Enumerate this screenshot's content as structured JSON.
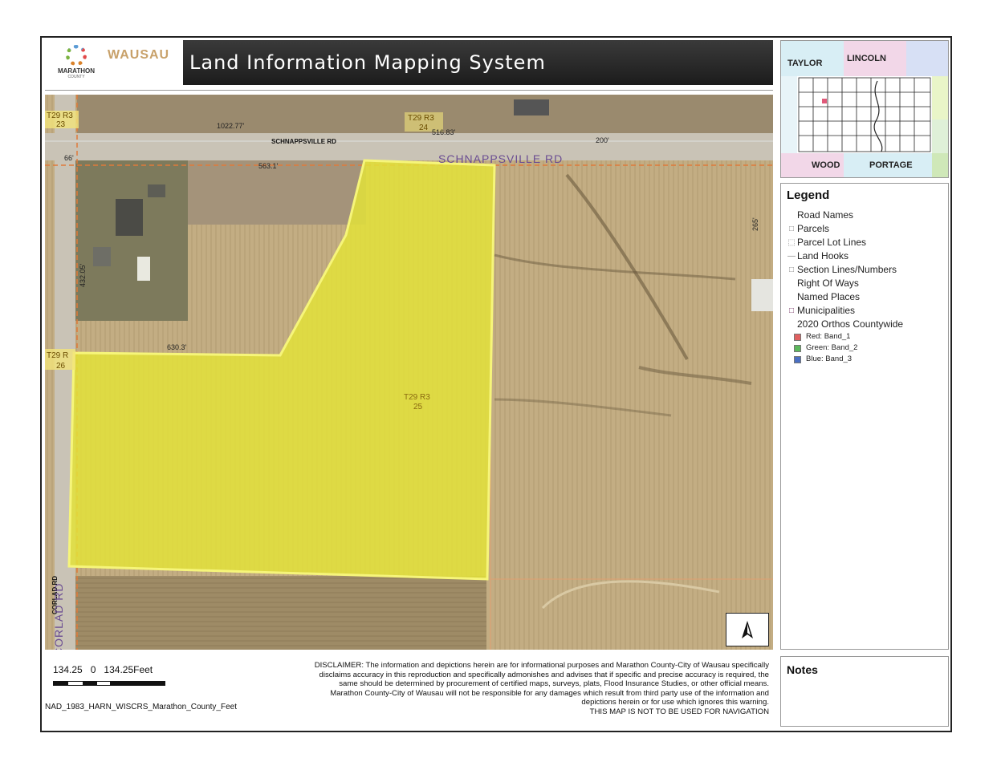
{
  "header": {
    "title": "Land Information Mapping System",
    "logo_marathon_line1": "MARATHON",
    "logo_marathon_line2": "COUNTY",
    "logo_wausau": "WAUSAU"
  },
  "map": {
    "roads": {
      "schnappsville_small": "SCHNAPPSVILLE RD",
      "schnappsville_large": "SCHNAPPSVILLE RD",
      "corlad_small": "CORLAD RD",
      "corlad_large": "CORLAD RD"
    },
    "sections": {
      "t29r3_23": "T29 R3",
      "t29r3_23_num": "23",
      "t29r3_24": "T29 R3",
      "t29r3_24_num": "24",
      "t29r_26": "T29 R",
      "t29r_26_num": "26",
      "t29r3_25": "T29 R3",
      "t29r3_25_num": "25"
    },
    "dimensions": {
      "d1022": "1022.77'",
      "d516": "516.83'",
      "d200": "200'",
      "d563": "563.1'",
      "d66": "66'",
      "d630": "630.3'",
      "d432": "432.05'",
      "d265": "265'"
    },
    "parcel_color": "#e3e23a"
  },
  "locator": {
    "counties": [
      "TAYLOR",
      "LINCOLN",
      "WOOD",
      "PORTAGE"
    ]
  },
  "legend": {
    "title": "Legend",
    "items": [
      "Road Names",
      "Parcels",
      "Parcel Lot Lines",
      "Land Hooks",
      "Section Lines/Numbers",
      "Right Of Ways",
      "Named Places",
      "Municipalities",
      "2020 Orthos Countywide"
    ],
    "bands": [
      {
        "label": "Red:   Band_1",
        "color": "#e06060"
      },
      {
        "label": "Green: Band_2",
        "color": "#5cb85c"
      },
      {
        "label": "Blue:  Band_3",
        "color": "#4a6fc2"
      }
    ]
  },
  "scale": {
    "left": "134.25",
    "zero": "0",
    "right": "134.25",
    "unit": "Feet",
    "projection": "NAD_1983_HARN_WISCRS_Marathon_County_Feet"
  },
  "disclaimer": {
    "lines": [
      "DISCLAIMER: The information and depictions herein are for informational purposes and Marathon County-City of Wausau specifically",
      "disclaims accuracy in this reproduction and specifically admonishes and advises that if specific and precise accuracy is required, the",
      "same should be determined by procurement of certified maps, surveys, plats, Flood Insurance Studies, or other official means.",
      "Marathon County-City of Wausau will not be responsible for any damages which result from third party use of the information and",
      "depictions herein or for use which ignores this warning.",
      "THIS MAP IS NOT TO BE USED FOR NAVIGATION"
    ]
  },
  "notes": {
    "title": "Notes"
  }
}
